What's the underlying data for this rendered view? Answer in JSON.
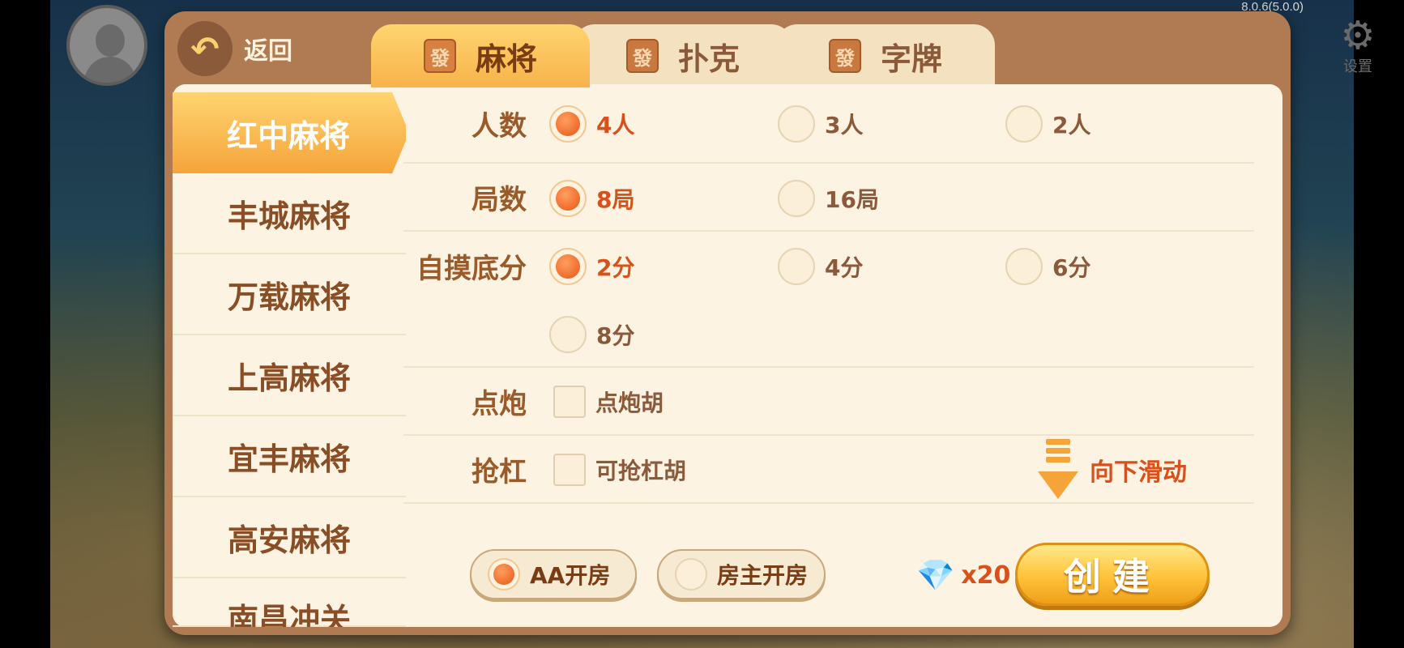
{
  "version": "8.0.6(5.0.0)",
  "settings_label": "设置",
  "header": {
    "back_label": "返回",
    "tabs": [
      {
        "tile": "發",
        "label": "麻将",
        "active": true
      },
      {
        "tile": "發",
        "label": "扑克",
        "active": false
      },
      {
        "tile": "發",
        "label": "字牌",
        "active": false
      }
    ]
  },
  "sidebar": {
    "items": [
      {
        "label": "红中麻将",
        "active": true
      },
      {
        "label": "丰城麻将",
        "active": false
      },
      {
        "label": "万载麻将",
        "active": false
      },
      {
        "label": "上高麻将",
        "active": false
      },
      {
        "label": "宜丰麻将",
        "active": false
      },
      {
        "label": "高安麻将",
        "active": false
      },
      {
        "label": "南昌冲关",
        "active": false
      }
    ]
  },
  "options": {
    "players": {
      "label": "人数",
      "choices": [
        {
          "text": "4人",
          "selected": true
        },
        {
          "text": "3人",
          "selected": false
        },
        {
          "text": "2人",
          "selected": false
        }
      ]
    },
    "rounds": {
      "label": "局数",
      "choices": [
        {
          "text": "8局",
          "selected": true
        },
        {
          "text": "16局",
          "selected": false
        }
      ]
    },
    "base_score": {
      "label": "自摸底分",
      "choices": [
        {
          "text": "2分",
          "selected": true
        },
        {
          "text": "4分",
          "selected": false
        },
        {
          "text": "6分",
          "selected": false
        },
        {
          "text": "8分",
          "selected": false
        }
      ]
    },
    "dianpao": {
      "label": "点炮",
      "check": {
        "text": "点炮胡",
        "checked": false
      }
    },
    "qianggang": {
      "label": "抢杠",
      "check": {
        "text": "可抢杠胡",
        "checked": false
      }
    }
  },
  "scroll_hint": "向下滑动",
  "footer": {
    "pay_aa": {
      "label": "AA开房",
      "selected": true
    },
    "pay_owner": {
      "label": "房主开房",
      "selected": false
    },
    "diamond_cost": "x20",
    "create_label": "创建"
  },
  "colors": {
    "accent": "#f6a43a",
    "selected_text": "#d8501a",
    "panel": "#b07a52",
    "content_bg": "#fcf3e2"
  }
}
